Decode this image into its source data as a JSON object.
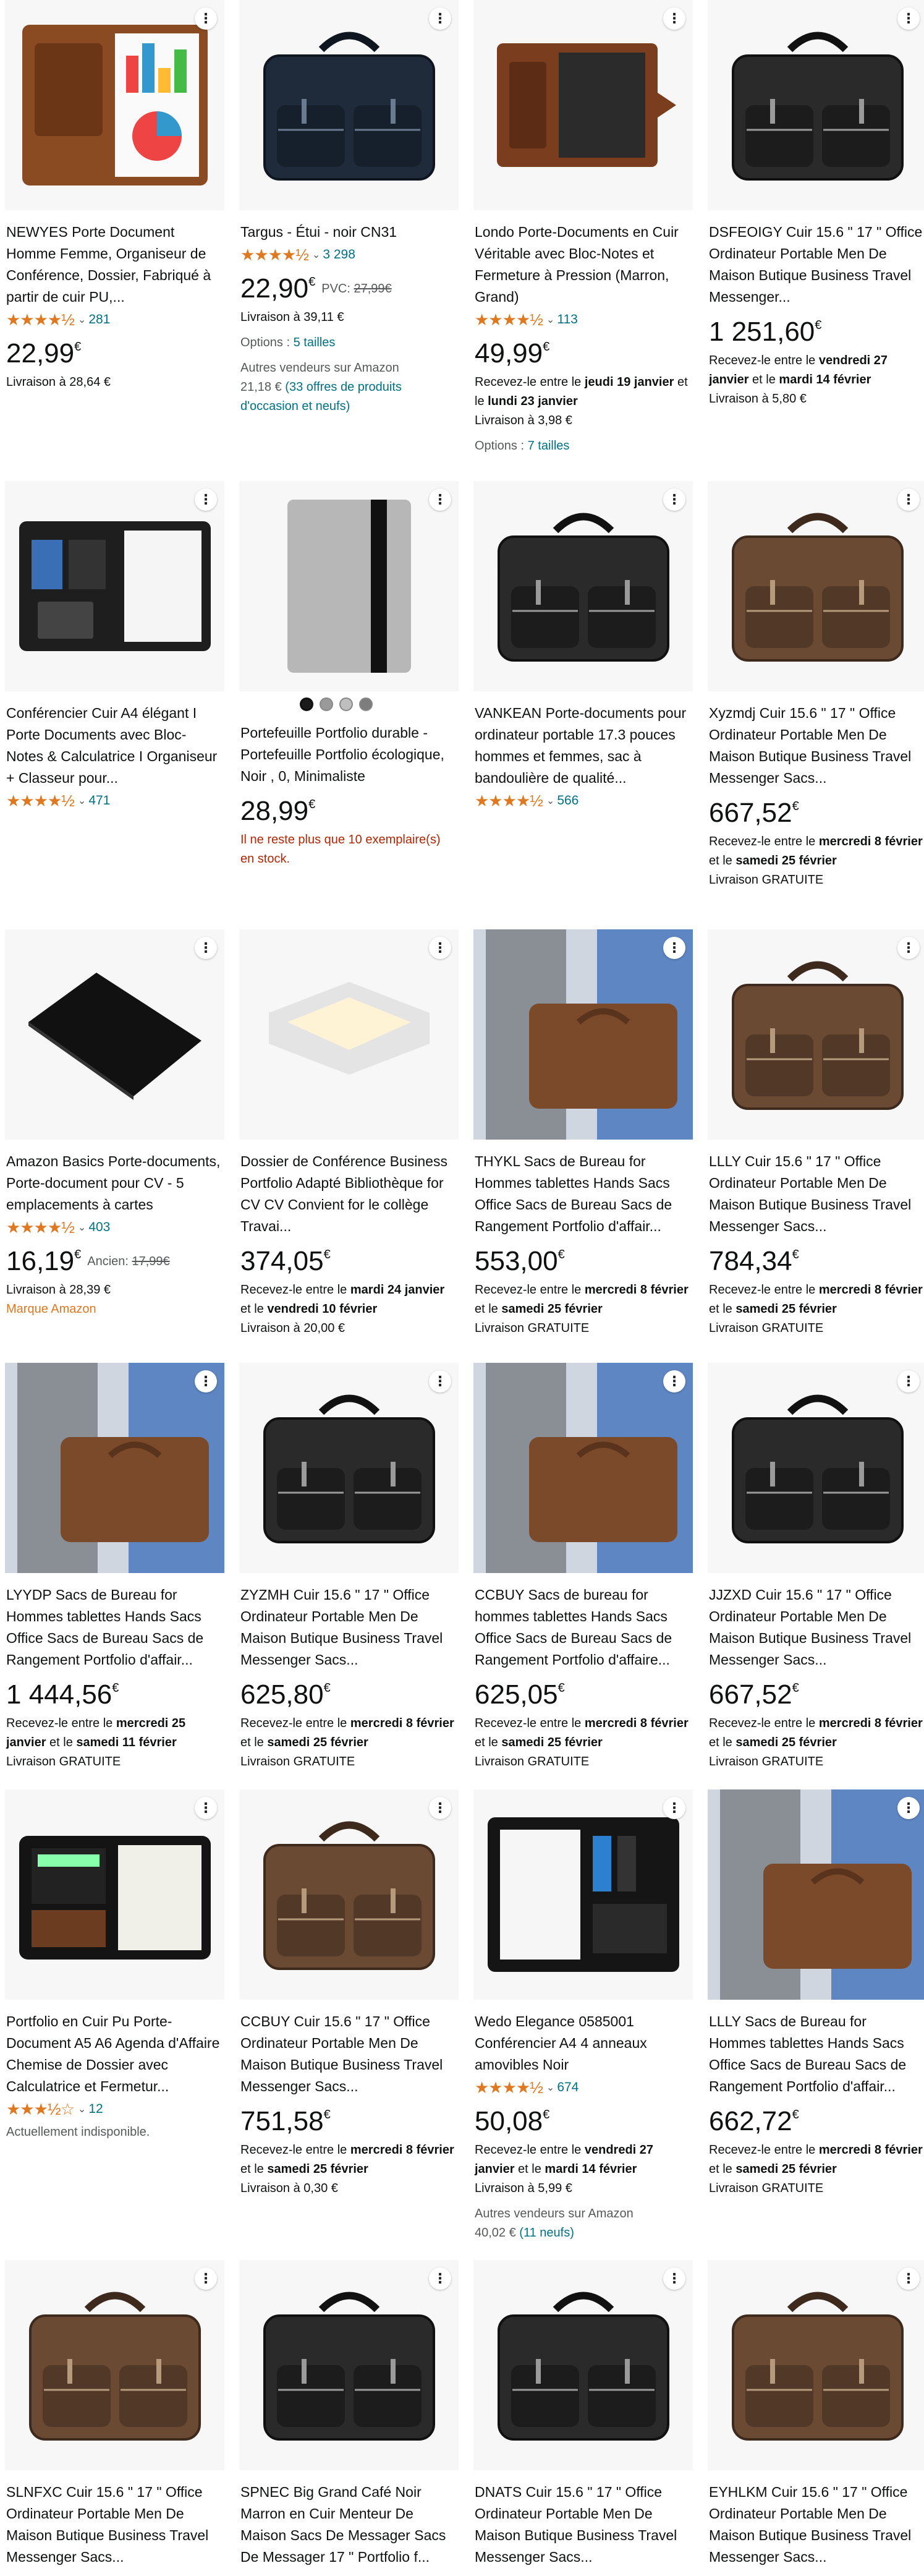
{
  "accent": "#DE7921",
  "link_color": "#007185",
  "stock_color": "#B12704",
  "more_icon": "⋮",
  "products": [
    {
      "icon": "padfolio-brown",
      "title": "NEWYES Porte Document Homme Femme, Organiseur de Conférence, Dossier, Fabriqué à partir de cuir PU,...",
      "stars": 4.5,
      "stars_text": "★★★★½",
      "reviews": "281",
      "price": "22,99",
      "currency": "€",
      "lines": [
        {
          "parts": [
            {
              "t": "Livraison à 28,64 €"
            }
          ]
        }
      ]
    },
    {
      "icon": "bag-navy",
      "title": "Targus - Étui - noir CN31",
      "stars": 4.5,
      "stars_text": "★★★★½",
      "reviews": "3 298",
      "price": "22,90",
      "currency": "€",
      "old_label": "PVC: ",
      "old_price": "27,99€",
      "lines": [
        {
          "parts": [
            {
              "t": "Livraison à 39,11 €"
            }
          ]
        },
        {
          "gap": true,
          "parts": [
            {
              "t": "Options : ",
              "c": "grey"
            },
            {
              "t": "5 tailles",
              "c": "link"
            }
          ]
        },
        {
          "gap": true,
          "parts": [
            {
              "t": "Autres vendeurs sur Amazon",
              "c": "grey"
            }
          ]
        },
        {
          "parts": [
            {
              "t": "21,18 € ",
              "c": "grey"
            },
            {
              "t": "(33 offres de produits d'occasion et neufs)",
              "c": "link"
            }
          ]
        }
      ]
    },
    {
      "icon": "folio-leather",
      "title": "Londo Porte-Documents en Cuir Véritable avec Bloc-Notes et Fermeture à Pression (Marron, Grand)",
      "stars": 4.5,
      "stars_text": "★★★★½",
      "reviews": "113",
      "price": "49,99",
      "currency": "€",
      "lines": [
        {
          "parts": [
            {
              "t": "Recevez-le entre le "
            },
            {
              "t": "jeudi 19 janvier",
              "b": true
            },
            {
              "t": " et le "
            },
            {
              "t": "lundi 23 janvier",
              "b": true
            }
          ]
        },
        {
          "parts": [
            {
              "t": "Livraison à 3,98 €"
            }
          ]
        },
        {
          "gap": true,
          "parts": [
            {
              "t": "Options : ",
              "c": "grey"
            },
            {
              "t": "7 tailles",
              "c": "link"
            }
          ]
        }
      ]
    },
    {
      "icon": "bag-black",
      "title": "DSFEOIGY Cuir 15.6 \" 17 \" Office Ordinateur Portable Men De Maison Butique Business Travel Messenger...",
      "price": "1 251,60",
      "currency": "€",
      "lines": [
        {
          "parts": [
            {
              "t": "Recevez-le entre le "
            },
            {
              "t": "vendredi 27 janvier",
              "b": true
            },
            {
              "t": " et le "
            },
            {
              "t": "mardi 14 février",
              "b": true
            }
          ]
        },
        {
          "parts": [
            {
              "t": "Livraison à 5,80 €"
            }
          ]
        }
      ]
    },
    {
      "icon": "padfolio-black",
      "title": "Conférencier Cuir A4 élégant I Porte Documents avec Bloc-Notes & Calculatrice I Organiseur + Classeur pour...",
      "stars": 4.5,
      "stars_text": "★★★★½",
      "reviews": "471",
      "lines": []
    },
    {
      "icon": "felt-sleeve",
      "swatches": 4,
      "title": "Portefeuille Portfolio durable - Portefeuille Portfolio écologique, Noir , 0, Minimaliste",
      "price": "28,99",
      "currency": "€",
      "lines": [
        {
          "parts": [
            {
              "t": "Il ne reste plus que 10 exemplaire(s) en stock.",
              "c": "stock"
            }
          ]
        }
      ]
    },
    {
      "icon": "bag-black",
      "title": "VANKEAN Porte-documents pour ordinateur portable 17.3 pouces hommes et femmes, sac à bandoulière de qualité...",
      "stars": 4.5,
      "stars_text": "★★★★½",
      "reviews": "566",
      "lines": []
    },
    {
      "icon": "bag-brown",
      "title": "Xyzmdj Cuir 15.6 \" 17 \" Office Ordinateur Portable Men De Maison Butique Business Travel Messenger Sacs...",
      "price": "667,52",
      "currency": "€",
      "lines": [
        {
          "parts": [
            {
              "t": "Recevez-le entre le "
            },
            {
              "t": "mercredi 8 février",
              "b": true
            },
            {
              "t": " et le "
            },
            {
              "t": "samedi 25 février",
              "b": true
            }
          ]
        },
        {
          "parts": [
            {
              "t": "Livraison GRATUITE"
            }
          ]
        }
      ]
    },
    {
      "icon": "folder-black",
      "title": "Amazon Basics Porte-documents, Porte-document pour CV - 5 emplacements à cartes",
      "stars": 4.5,
      "stars_text": "★★★★½",
      "reviews": "403",
      "price": "16,19",
      "currency": "€",
      "old_label": "Ancien: ",
      "old_price": "17,99€",
      "lines": [
        {
          "parts": [
            {
              "t": "Livraison à 28,39 €"
            }
          ]
        },
        {
          "parts": [
            {
              "t": "Marque Amazon",
              "c": "brand"
            }
          ]
        }
      ]
    },
    {
      "icon": "ceiling-lamp",
      "title": "Dossier de Conférence Business Portfolio Adapté Bibliothèque for CV CV Convient for le collège Travai...",
      "price": "374,05",
      "currency": "€",
      "lines": [
        {
          "parts": [
            {
              "t": "Recevez-le entre le "
            },
            {
              "t": "mardi 24 janvier",
              "b": true
            },
            {
              "t": " et le "
            },
            {
              "t": "vendredi 10 février",
              "b": true
            }
          ]
        },
        {
          "parts": [
            {
              "t": "Livraison à 20,00 €"
            }
          ]
        }
      ]
    },
    {
      "icon": "man-folio",
      "title": "THYKL Sacs de Bureau for Hommes tablettes Hands Sacs Office Sacs de Bureau Sacs de Rangement Portfolio d'affair...",
      "price": "553,00",
      "currency": "€",
      "lines": [
        {
          "parts": [
            {
              "t": "Recevez-le entre le "
            },
            {
              "t": "mercredi 8 février",
              "b": true
            },
            {
              "t": " et le "
            },
            {
              "t": "samedi 25 février",
              "b": true
            }
          ]
        },
        {
          "parts": [
            {
              "t": "Livraison GRATUITE"
            }
          ]
        }
      ]
    },
    {
      "icon": "bag-brown",
      "title": "LLLY Cuir 15.6 \" 17 \" Office Ordinateur Portable Men De Maison Butique Business Travel Messenger Sacs...",
      "price": "784,34",
      "currency": "€",
      "lines": [
        {
          "parts": [
            {
              "t": "Recevez-le entre le "
            },
            {
              "t": "mercredi 8 février",
              "b": true
            },
            {
              "t": " et le "
            },
            {
              "t": "samedi 25 février",
              "b": true
            }
          ]
        },
        {
          "parts": [
            {
              "t": "Livraison GRATUITE"
            }
          ]
        }
      ]
    },
    {
      "icon": "man-folio",
      "title": "LYYDP Sacs de Bureau for Hommes tablettes Hands Sacs Office Sacs de Bureau Sacs de Rangement Portfolio d'affair...",
      "price": "1 444,56",
      "currency": "€",
      "lines": [
        {
          "parts": [
            {
              "t": "Recevez-le entre le "
            },
            {
              "t": "mercredi 25 janvier",
              "b": true
            },
            {
              "t": " et le "
            },
            {
              "t": "samedi 11 février",
              "b": true
            }
          ]
        },
        {
          "parts": [
            {
              "t": "Livraison GRATUITE"
            }
          ]
        }
      ]
    },
    {
      "icon": "bag-black",
      "title": "ZYZMH Cuir 15.6 \" 17 \" Office Ordinateur Portable Men De Maison Butique Business Travel Messenger Sacs...",
      "price": "625,80",
      "currency": "€",
      "lines": [
        {
          "parts": [
            {
              "t": "Recevez-le entre le "
            },
            {
              "t": "mercredi 8 février",
              "b": true
            },
            {
              "t": " et le "
            },
            {
              "t": "samedi 25 février",
              "b": true
            }
          ]
        },
        {
          "parts": [
            {
              "t": "Livraison GRATUITE"
            }
          ]
        }
      ]
    },
    {
      "icon": "man-folio",
      "title": "CCBUY Sacs de bureau for hommes tablettes Hands Sacs Office Sacs de Bureau Sacs de Rangement Portfolio d'affaire...",
      "price": "625,05",
      "currency": "€",
      "lines": [
        {
          "parts": [
            {
              "t": "Recevez-le entre le "
            },
            {
              "t": "mercredi 8 février",
              "b": true
            },
            {
              "t": " et le "
            },
            {
              "t": "samedi 25 février",
              "b": true
            }
          ]
        },
        {
          "parts": [
            {
              "t": "Livraison GRATUITE"
            }
          ]
        }
      ]
    },
    {
      "icon": "bag-black",
      "title": "JJZXD Cuir 15.6 \" 17 \" Office Ordinateur Portable Men De Maison Butique Business Travel Messenger Sacs...",
      "price": "667,52",
      "currency": "€",
      "lines": [
        {
          "parts": [
            {
              "t": "Recevez-le entre le "
            },
            {
              "t": "mercredi 8 février",
              "b": true
            },
            {
              "t": " et le "
            },
            {
              "t": "samedi 25 février",
              "b": true
            }
          ]
        },
        {
          "parts": [
            {
              "t": "Livraison GRATUITE"
            }
          ]
        }
      ]
    },
    {
      "icon": "padfolio-calc",
      "title": "Portfolio en Cuir Pu Porte-Document A5 A6 Agenda d'Affaire Chemise de Dossier avec Calculatrice et Fermetur...",
      "stars": 3.5,
      "stars_text": "★★★½☆",
      "reviews": "12",
      "lines": [
        {
          "parts": [
            {
              "t": "Actuellement indisponible.",
              "c": "grey"
            }
          ]
        }
      ]
    },
    {
      "icon": "bag-brown",
      "title": "CCBUY Cuir 15.6 \" 17 \" Office Ordinateur Portable Men De Maison Butique Business Travel Messenger Sacs...",
      "price": "751,58",
      "currency": "€",
      "lines": [
        {
          "parts": [
            {
              "t": "Recevez-le entre le "
            },
            {
              "t": "mercredi 8 février",
              "b": true
            },
            {
              "t": " et le "
            },
            {
              "t": "samedi 25 février",
              "b": true
            }
          ]
        },
        {
          "parts": [
            {
              "t": "Livraison à 0,30 €"
            }
          ]
        }
      ]
    },
    {
      "icon": "padfolio-open",
      "title": "Wedo Elegance 0585001 Conférencier A4 4 anneaux amovibles Noir",
      "stars": 4.5,
      "stars_text": "★★★★½",
      "reviews": "674",
      "price": "50,08",
      "currency": "€",
      "lines": [
        {
          "parts": [
            {
              "t": "Recevez-le entre le "
            },
            {
              "t": "vendredi 27 janvier",
              "b": true
            },
            {
              "t": " et le "
            },
            {
              "t": "mardi 14 février",
              "b": true
            }
          ]
        },
        {
          "parts": [
            {
              "t": "Livraison à 5,99 €"
            }
          ]
        },
        {
          "gap": true,
          "parts": [
            {
              "t": "Autres vendeurs sur Amazon",
              "c": "grey"
            }
          ]
        },
        {
          "parts": [
            {
              "t": "40,02 € ",
              "c": "grey"
            },
            {
              "t": "(11 neufs)",
              "c": "link"
            }
          ]
        }
      ]
    },
    {
      "icon": "man-folio",
      "title": "LLLY Sacs de Bureau for Hommes tablettes Hands Sacs Office Sacs de Bureau Sacs de Rangement Portfolio d'affair...",
      "price": "662,72",
      "currency": "€",
      "lines": [
        {
          "parts": [
            {
              "t": "Recevez-le entre le "
            },
            {
              "t": "mercredi 8 février",
              "b": true
            },
            {
              "t": " et le "
            },
            {
              "t": "samedi 25 février",
              "b": true
            }
          ]
        },
        {
          "parts": [
            {
              "t": "Livraison GRATUITE"
            }
          ]
        }
      ]
    },
    {
      "icon": "bag-brown",
      "title": "SLNFXC Cuir 15.6 \" 17 \" Office Ordinateur Portable Men De Maison Butique Business Travel Messenger Sacs...",
      "lines": []
    },
    {
      "icon": "bag-black",
      "title": "SPNEC Big Grand Café Noir Marron en Cuir Menteur De Maison Sacs De Messager Sacs De Messager 17 \" Portfolio f...",
      "lines": []
    },
    {
      "icon": "bag-black",
      "title": "DNATS Cuir 15.6 \" 17 \" Office Ordinateur Portable Men De Maison Butique Business Travel Messenger Sacs...",
      "lines": []
    },
    {
      "icon": "bag-brown",
      "title": "EYHLKM Cuir 15.6 \" 17 \" Office Ordinateur Portable Men De Maison Butique Business Travel Messenger Sacs...",
      "lines": []
    }
  ]
}
